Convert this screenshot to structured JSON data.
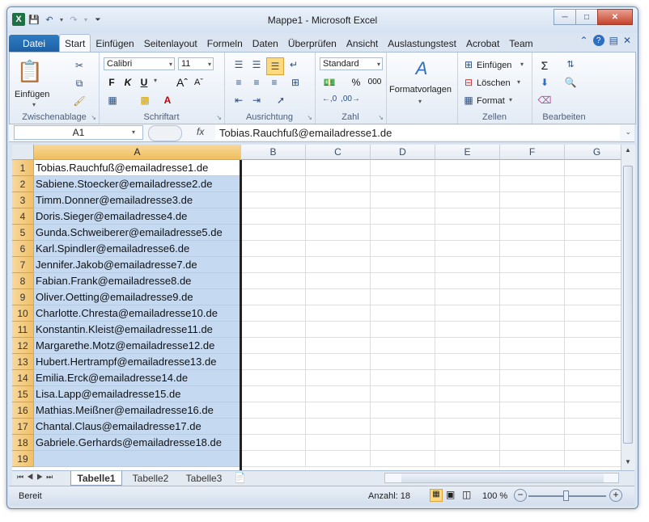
{
  "window": {
    "title": "Mappe1  -  Microsoft Excel",
    "app_icon": "X"
  },
  "ribbon_tabs": {
    "file": "Datei",
    "items": [
      "Start",
      "Einfügen",
      "Seitenlayout",
      "Formeln",
      "Daten",
      "Überprüfen",
      "Ansicht",
      "Auslastungstest",
      "Acrobat",
      "Team"
    ]
  },
  "groups": {
    "clipboard": {
      "label": "Zwischenablage",
      "paste": "Einfügen"
    },
    "font": {
      "label": "Schriftart",
      "name": "Calibri",
      "size": "11",
      "bold": "F",
      "italic": "K",
      "underline": "U"
    },
    "alignment": {
      "label": "Ausrichtung"
    },
    "number": {
      "label": "Zahl",
      "format": "Standard",
      "percent": "%",
      "thousands": "000"
    },
    "styles": {
      "label": "Formatvorlagen"
    },
    "cells": {
      "label": "Zellen",
      "insert": "Einfügen",
      "delete": "Löschen",
      "format": "Format"
    },
    "editing": {
      "label": "Bearbeiten"
    }
  },
  "formula_bar": {
    "name_box": "A1",
    "fx": "fx",
    "content": "Tobias.Rauchfuß@emailadresse1.de"
  },
  "columns": [
    "A",
    "B",
    "C",
    "D",
    "E",
    "F",
    "G"
  ],
  "rows": [
    {
      "n": "1",
      "a": "Tobias.Rauchfuß@emailadresse1.de"
    },
    {
      "n": "2",
      "a": "Sabiene.Stoecker@emailadresse2.de"
    },
    {
      "n": "3",
      "a": "Timm.Donner@emailadresse3.de"
    },
    {
      "n": "4",
      "a": "Doris.Sieger@emailadresse4.de"
    },
    {
      "n": "5",
      "a": "Gunda.Schweiberer@emailadresse5.de"
    },
    {
      "n": "6",
      "a": "Karl.Spindler@emailadresse6.de"
    },
    {
      "n": "7",
      "a": "Jennifer.Jakob@emailadresse7.de"
    },
    {
      "n": "8",
      "a": "Fabian.Frank@emailadresse8.de"
    },
    {
      "n": "9",
      "a": "Oliver.Oetting@emailadresse9.de"
    },
    {
      "n": "10",
      "a": "Charlotte.Chresta@emailadresse10.de"
    },
    {
      "n": "11",
      "a": "Konstantin.Kleist@emailadresse11.de"
    },
    {
      "n": "12",
      "a": "Margarethe.Motz@emailadresse12.de"
    },
    {
      "n": "13",
      "a": "Hubert.Hertrampf@emailadresse13.de"
    },
    {
      "n": "14",
      "a": "Emilia.Erck@emailadresse14.de"
    },
    {
      "n": "15",
      "a": "Lisa.Lapp@emailadresse15.de"
    },
    {
      "n": "16",
      "a": "Mathias.Meißner@emailadresse16.de"
    },
    {
      "n": "17",
      "a": "Chantal.Claus@emailadresse17.de"
    },
    {
      "n": "18",
      "a": "Gabriele.Gerhards@emailadresse18.de"
    },
    {
      "n": "19",
      "a": ""
    }
  ],
  "sheets": [
    "Tabelle1",
    "Tabelle2",
    "Tabelle3"
  ],
  "status": {
    "mode": "Bereit",
    "count": "Anzahl: 18",
    "zoom": "100 %"
  }
}
